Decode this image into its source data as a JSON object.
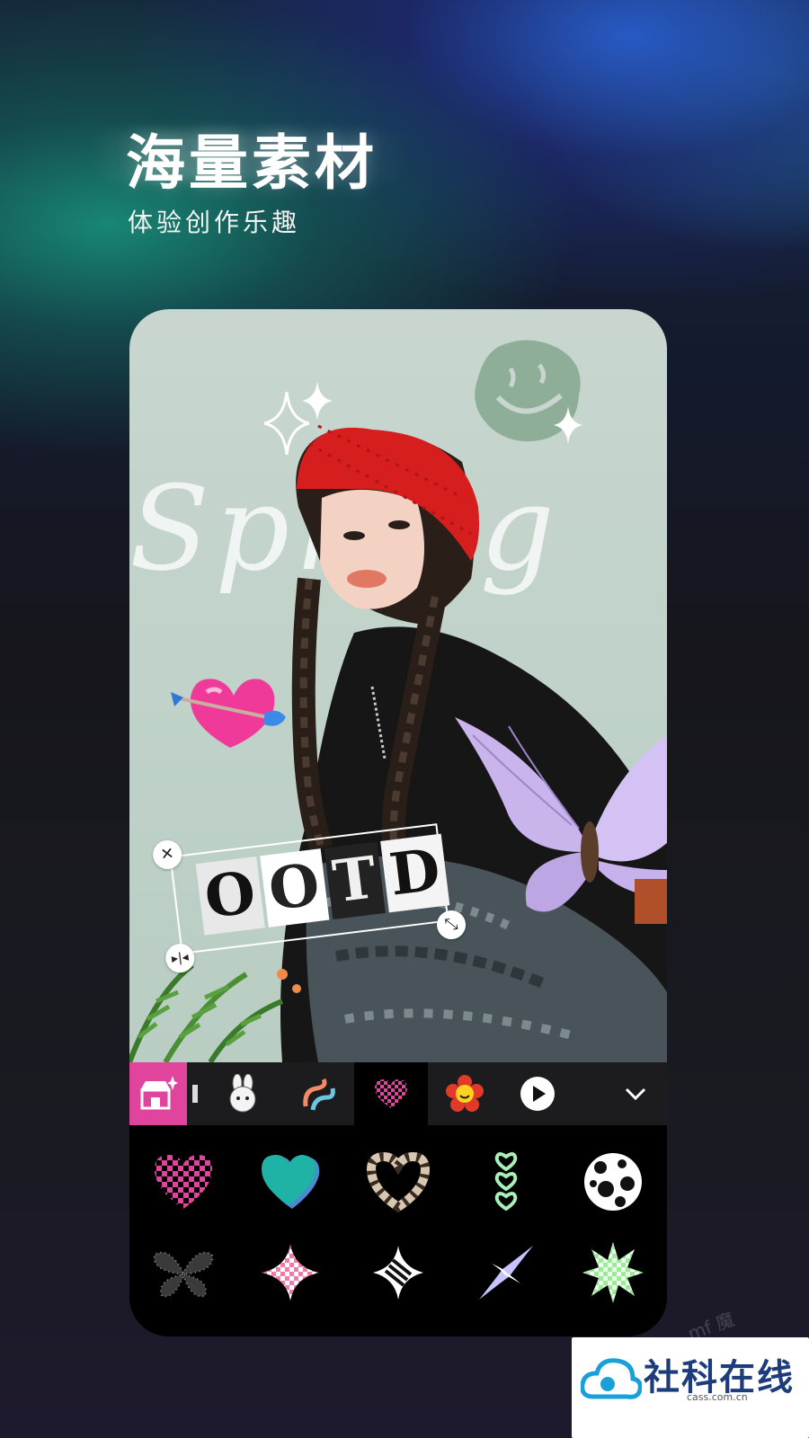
{
  "headline": "海量素材",
  "subheadline": "体验创作乐趣",
  "canvas": {
    "background_word": "Spring",
    "text_sticker": {
      "letters": [
        "O",
        "O",
        "T",
        "D"
      ]
    }
  },
  "sticker_panel": {
    "tabs": [
      {
        "icon": "sticker-store-icon"
      },
      {
        "icon": "bunny-sticker-icon"
      },
      {
        "icon": "squiggle-sticker-icon"
      },
      {
        "icon": "checker-heart-icon",
        "selected": true
      },
      {
        "icon": "flower-smiley-icon"
      },
      {
        "icon": "play-icon"
      },
      {
        "icon": "chevron-down-icon"
      }
    ],
    "stickers": [
      {
        "name": "pink-checker-heart-icon",
        "color": "#e0449c"
      },
      {
        "name": "teal-heart-icon",
        "color": "#1fb3a6"
      },
      {
        "name": "zebra-heart-icon",
        "color": "#d8c7b0"
      },
      {
        "name": "triple-heart-chain-icon",
        "color": "#a8f0b8"
      },
      {
        "name": "cow-print-ball-icon",
        "color": "#ffffff"
      },
      {
        "name": "glitter-butterfly-icon",
        "color": "#555555"
      },
      {
        "name": "pink-checker-star-icon",
        "color": "#f37aa8"
      },
      {
        "name": "zebra-star-icon",
        "color": "#ffffff"
      },
      {
        "name": "lilac-spark-icon",
        "color": "#c6c4ff"
      },
      {
        "name": "green-checker-burst-icon",
        "color": "#b8f0b0"
      }
    ]
  },
  "watermark": {
    "brand": "社科在线",
    "url": "cass.com.cn",
    "faint": "mf 魔"
  },
  "colors": {
    "accent_pink": "#e0449c",
    "hat_red": "#d61e1e",
    "canvas_bg": "#c0d2c9"
  }
}
